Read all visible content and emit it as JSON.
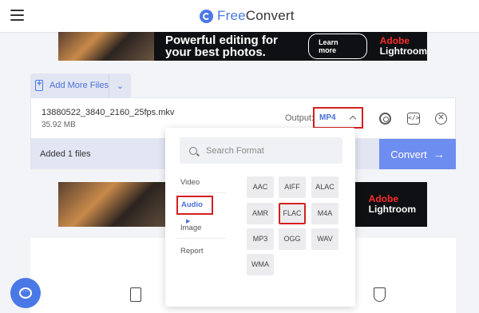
{
  "header": {
    "brand_free": "Free",
    "brand_convert": "Convert"
  },
  "ads": {
    "top": {
      "headline": "Powerful editing for your best photos.",
      "cta": "Learn more",
      "brand_adobe": "Adobe",
      "brand_product": "Lightroom"
    },
    "bottom": {
      "brand_adobe": "Adobe",
      "brand_product": "Lightroom"
    }
  },
  "toolbar": {
    "add_more_label": "Add More Files"
  },
  "file": {
    "name": "13880522_3840_2160_25fps.mkv",
    "size": "35.92 MB",
    "output_label": "Output:",
    "output_value": "MP4"
  },
  "files_bar": {
    "added_text": "Added 1 files",
    "convert_label": "Convert"
  },
  "dropdown": {
    "search_placeholder": "Search Format",
    "categories": [
      "Video",
      "Audio",
      "Image",
      "Report"
    ],
    "selected_category": "Audio",
    "formats": [
      "AAC",
      "AIFF",
      "ALAC",
      "AMR",
      "FLAC",
      "M4A",
      "MP3",
      "OGG",
      "WAV",
      "WMA"
    ],
    "selected_format": "FLAC"
  },
  "colors": {
    "accent": "#4a78e6",
    "highlight_box": "#d42020",
    "convert_button": "#6e8df0"
  },
  "icons": {
    "menu": "hamburger-icon",
    "logo": "freeconvert-logo-icon",
    "add_file": "file-plus-icon",
    "settings": "gear-icon",
    "embed": "code-icon",
    "remove": "close-icon",
    "search": "search-icon",
    "chat": "chat-icon",
    "document": "document-icon",
    "security": "shield-icon"
  }
}
